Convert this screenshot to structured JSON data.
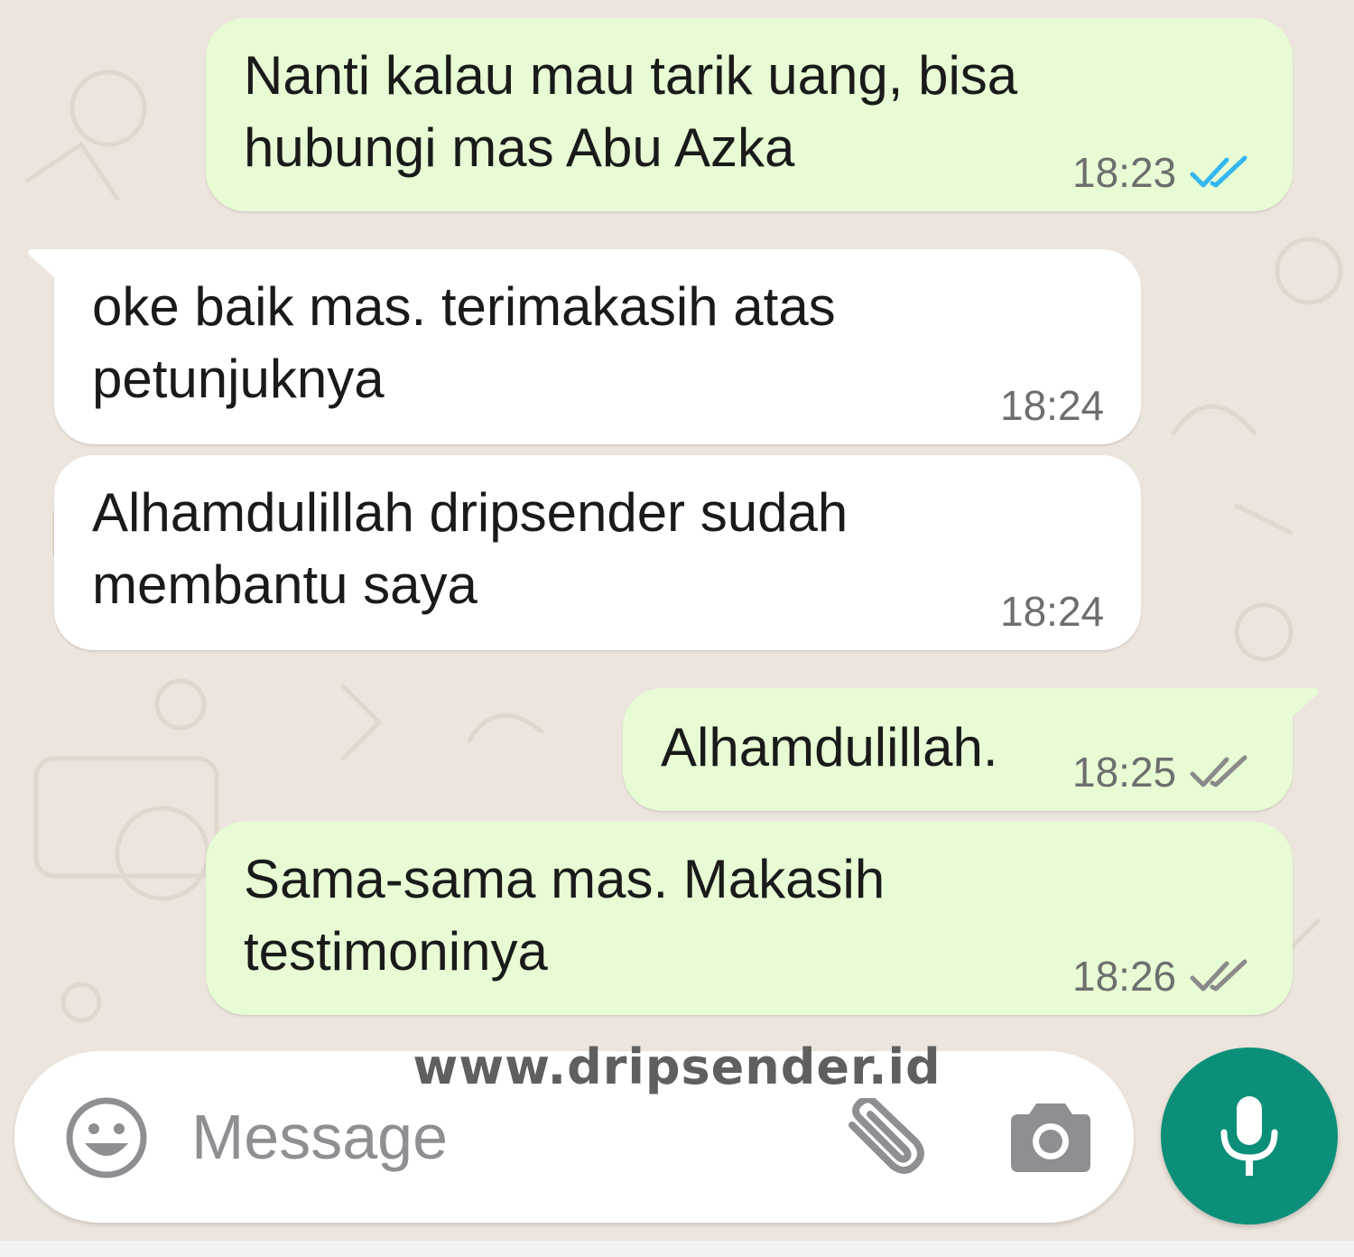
{
  "messages": [
    {
      "direction": "out",
      "text": "Nanti kalau mau tarik uang, bisa\nhubungi mas Abu Azka",
      "time": "18:23",
      "status": "read"
    },
    {
      "direction": "in",
      "text": "oke baik mas. terimakasih atas\npetunjuknya",
      "time": "18:24"
    },
    {
      "direction": "in",
      "text": "Alhamdulillah dripsender sudah\nmembantu saya",
      "time": "18:24"
    },
    {
      "direction": "out",
      "text": "Alhamdulillah.",
      "time": "18:25",
      "status": "delivered"
    },
    {
      "direction": "out",
      "text": "Sama-sama mas. Makasih\ntestimoninya",
      "time": "18:26",
      "status": "delivered"
    }
  ],
  "composer": {
    "placeholder": "Message"
  },
  "watermark": "www.dripsender.id",
  "icons": {
    "emoji": "emoji-icon",
    "attach": "paperclip-icon",
    "camera": "camera-icon",
    "mic": "mic-icon",
    "read_ticks": "double-check-icon",
    "delivered_ticks": "double-check-icon"
  },
  "colors": {
    "outgoing_bubble": "#e7fcd4",
    "incoming_bubble": "#ffffff",
    "chat_background": "#ece5dd",
    "read_tick": "#34b7f1",
    "delivered_tick": "#8a8a8a",
    "mic_button": "#0c8f78"
  }
}
